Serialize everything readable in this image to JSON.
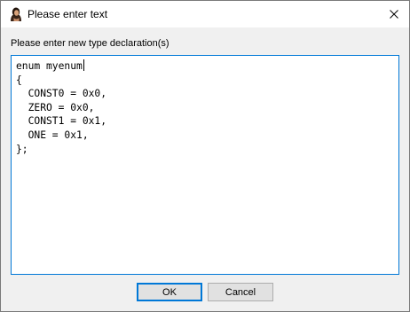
{
  "window": {
    "title": "Please enter text",
    "icon": "user-portrait-icon",
    "close_icon": "close-icon"
  },
  "prompt": {
    "label": "Please enter new type declaration(s)"
  },
  "editor": {
    "lines": [
      "enum myenum",
      "{",
      "  CONST0 = 0x0,",
      "  ZERO = 0x0,",
      "  CONST1 = 0x1,",
      "  ONE = 0x1,",
      "};"
    ]
  },
  "buttons": {
    "ok_label": "OK",
    "cancel_label": "Cancel"
  },
  "colors": {
    "focus_accent": "#0078d7",
    "dialog_background": "#f0f0f0",
    "button_face": "#e1e1e1"
  }
}
